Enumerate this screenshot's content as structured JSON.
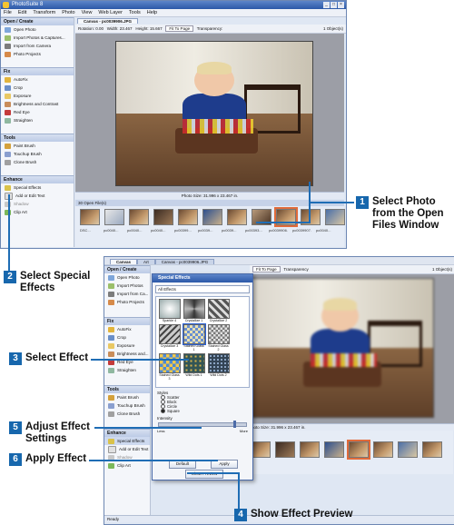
{
  "app": {
    "title": "PhotoSuite 8"
  },
  "menu": [
    "File",
    "Edit",
    "Transform",
    "Photo",
    "View",
    "Web Layer",
    "Tools",
    "Help"
  ],
  "win1": {
    "tabs": [
      "Canvas - pc0039906.JPG"
    ],
    "options": [
      "Rotation: 0.00",
      "Width: 23.467",
      "Height: 15.667",
      "Fit To Page",
      "Transparency:"
    ],
    "objects": "1 Object(s)",
    "panel": {
      "sections": [
        {
          "title": "Open / Create",
          "items": [
            "Open Photo",
            "Import Photos & Captures...",
            "Import from Camera",
            "Photo Projects"
          ]
        },
        {
          "title": "Fix",
          "items": [
            "AutoFix",
            "Crop",
            "Exposure",
            "Brightness and Contrast",
            "Red Eye",
            "Straighten"
          ]
        },
        {
          "title": "Tools",
          "items": [
            "Paint Brush",
            "Touchup Brush",
            "Clone Brush"
          ]
        },
        {
          "title": "Enhance",
          "items": [
            "Special Effects",
            "Add or Edit Text",
            "Shadow",
            "Clip Art"
          ]
        }
      ]
    },
    "photo_size": "Photo Size: 31.996 x 23.467 in.",
    "filmstrip_title": "30 Open File(s)",
    "captions": [
      "DSC...",
      "pc0040...",
      "pc0040...",
      "pc0040...",
      "pc00399...",
      "pc0039...",
      "pc0039...",
      "pc00393...",
      "pc0039906.JPG",
      "pc0039907...",
      "pc0040...",
      "pc0040..."
    ]
  },
  "win2": {
    "tabs": [
      "Canvas",
      "Art",
      "Canvas - pc0039906.JPG"
    ],
    "options": [
      "Fit To Page",
      "Transparency",
      "1 Object(s)"
    ],
    "panel_sections": [
      "Open / Create",
      "Fix",
      "Tools",
      "Enhance"
    ],
    "panel_items": [
      "Open Photo",
      "Import Photos",
      "Import from Ca...",
      "Photo Projects",
      "AutoFix",
      "Crop",
      "Exposure",
      "Brightness and...",
      "Red Eye",
      "Straighten",
      "Paint Brush",
      "Touchup Brush",
      "Clone Brush",
      "Special Effects",
      "Add or Edit Text",
      "Shadow",
      "Clip Art"
    ],
    "photo_size": "Photo Size: 31.996 x 23.467 in.",
    "status_left": "Ready"
  },
  "dialog": {
    "title": "Special Effects",
    "category": "All Effects",
    "effects": [
      "Sparkle 4",
      "Crystallize 1",
      "Crystallize 2",
      "Crystallize 3",
      "Stained Glass 1",
      "Stained Glass 2",
      "Stained Glass 3",
      "Wild Dots 1",
      "Wild Dots 2"
    ],
    "selected_effect": "Stained Glass 1",
    "styles_label": "Styles",
    "styles": [
      "Scatter",
      "Block",
      "Circle",
      "Square"
    ],
    "selected_style": "Square",
    "intensity_label": "Intensity",
    "intensity_min": "Less",
    "intensity_max": "More",
    "intensity_value": 0.85,
    "buttons": {
      "default": "Default",
      "apply": "Apply",
      "preview": "Show Preview"
    }
  },
  "callouts": [
    {
      "num": "1",
      "text": "Select Photo from the Open Files Window"
    },
    {
      "num": "2",
      "text": "Select Special Effects"
    },
    {
      "num": "3",
      "text": "Select Effect"
    },
    {
      "num": "4",
      "text": "Show Effect Preview"
    },
    {
      "num": "5",
      "text": "Adjust Effect Settings"
    },
    {
      "num": "6",
      "text": "Apply Effect"
    }
  ],
  "colors": {
    "callout_blue": "#1767ad",
    "titlebar": "#2c59a8",
    "selection": "#e06a3a"
  }
}
